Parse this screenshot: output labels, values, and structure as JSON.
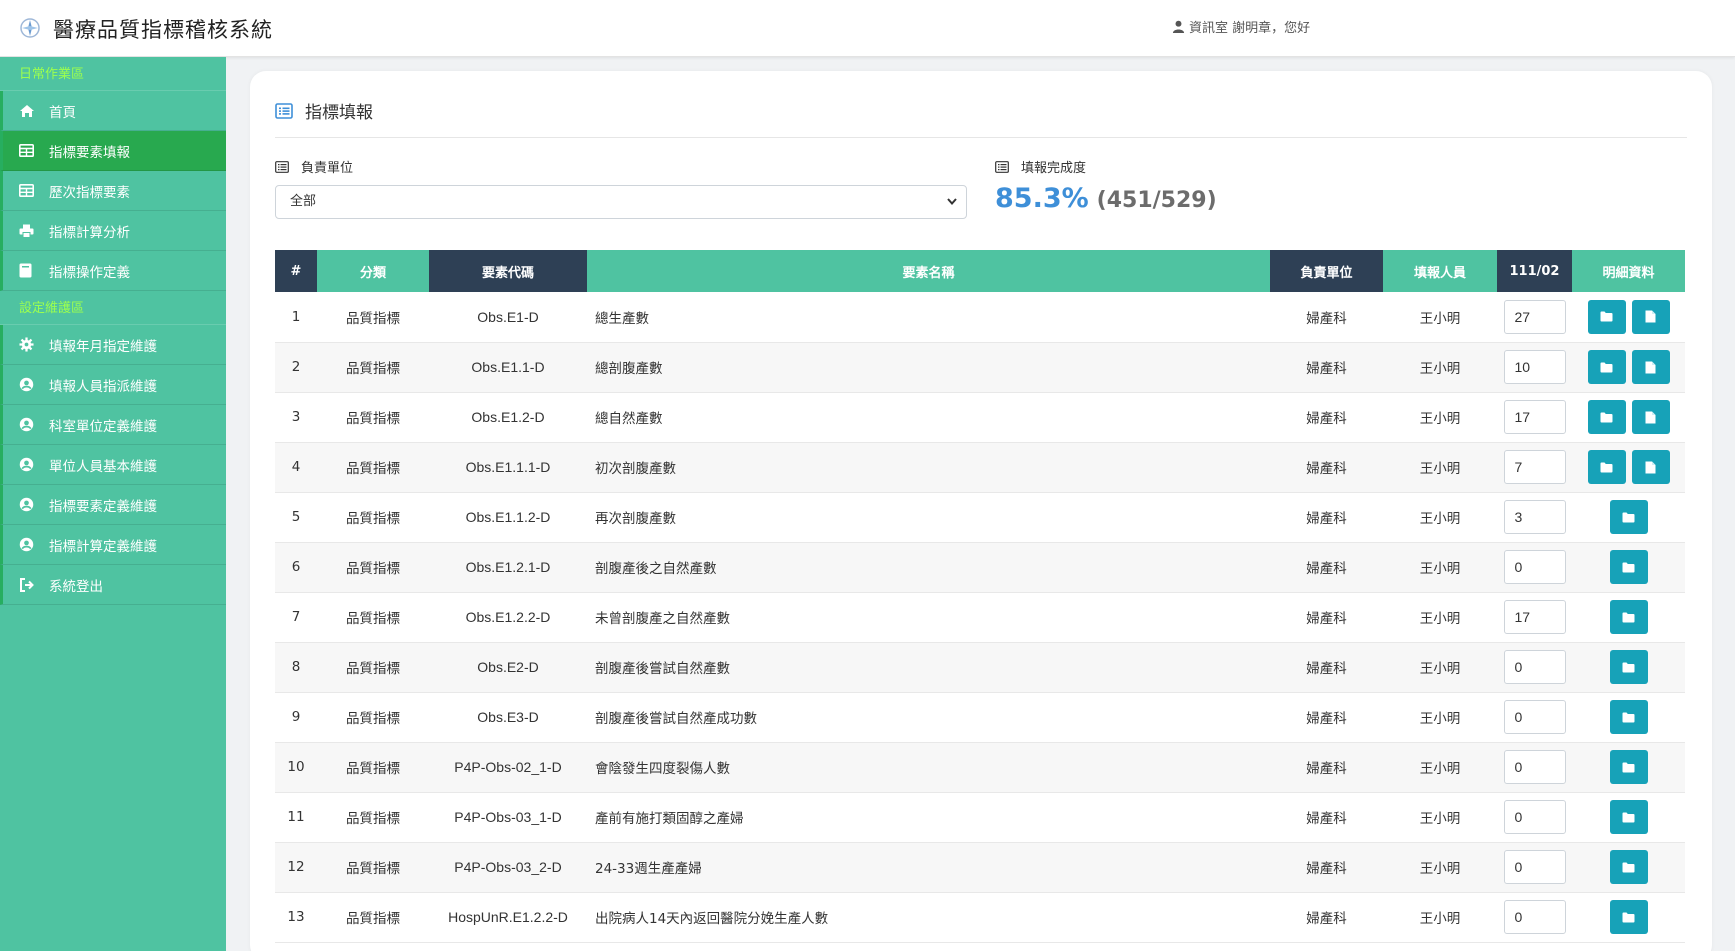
{
  "header": {
    "app_title": "醫療品質指標稽核系統",
    "user_text": "資訊室 謝明章，您好"
  },
  "sidebar": {
    "section1": "日常作業區",
    "items1": [
      {
        "label": "首頁",
        "icon": "home-icon"
      },
      {
        "label": "指標要素填報",
        "icon": "table-icon",
        "active": true
      },
      {
        "label": "歷次指標要素",
        "icon": "table-icon"
      },
      {
        "label": "指標計算分析",
        "icon": "print-icon"
      },
      {
        "label": "指標操作定義",
        "icon": "book-icon"
      }
    ],
    "section2": "設定維護區",
    "items2": [
      {
        "label": "填報年月指定維護",
        "icon": "gear-icon"
      },
      {
        "label": "填報人員指派維護",
        "icon": "user-circle-icon"
      },
      {
        "label": "科室單位定義維護",
        "icon": "user-circle-icon"
      },
      {
        "label": "單位人員基本維護",
        "icon": "user-circle-icon"
      },
      {
        "label": "指標要素定義維護",
        "icon": "user-circle-icon"
      },
      {
        "label": "指標計算定義維護",
        "icon": "user-circle-icon"
      },
      {
        "label": "系統登出",
        "icon": "sign-out-icon"
      }
    ]
  },
  "main": {
    "title": "指標填報",
    "unit_label": "負責單位",
    "unit_selected": "全部",
    "progress_label": "填報完成度",
    "progress_percent": "85.3%",
    "progress_count": "(451/529)"
  },
  "table": {
    "headers": {
      "idx": "#",
      "category": "分類",
      "code": "要素代碼",
      "name": "要素名稱",
      "unit": "負責單位",
      "filler": "填報人員",
      "period": "111/02",
      "detail": "明細資料"
    },
    "rows": [
      {
        "idx": "1",
        "category": "品質指標",
        "code": "Obs.E1-D",
        "name": "總生產數",
        "unit": "婦產科",
        "filler": "王小明",
        "value": "27",
        "doc": true
      },
      {
        "idx": "2",
        "category": "品質指標",
        "code": "Obs.E1.1-D",
        "name": "總剖腹產數",
        "unit": "婦產科",
        "filler": "王小明",
        "value": "10",
        "doc": true
      },
      {
        "idx": "3",
        "category": "品質指標",
        "code": "Obs.E1.2-D",
        "name": "總自然產數",
        "unit": "婦產科",
        "filler": "王小明",
        "value": "17",
        "doc": true
      },
      {
        "idx": "4",
        "category": "品質指標",
        "code": "Obs.E1.1.1-D",
        "name": "初次剖腹產數",
        "unit": "婦產科",
        "filler": "王小明",
        "value": "7",
        "doc": true
      },
      {
        "idx": "5",
        "category": "品質指標",
        "code": "Obs.E1.1.2-D",
        "name": "再次剖腹產數",
        "unit": "婦產科",
        "filler": "王小明",
        "value": "3",
        "doc": false
      },
      {
        "idx": "6",
        "category": "品質指標",
        "code": "Obs.E1.2.1-D",
        "name": "剖腹產後之自然產數",
        "unit": "婦產科",
        "filler": "王小明",
        "value": "0",
        "doc": false
      },
      {
        "idx": "7",
        "category": "品質指標",
        "code": "Obs.E1.2.2-D",
        "name": "未曾剖腹產之自然產數",
        "unit": "婦產科",
        "filler": "王小明",
        "value": "17",
        "doc": false
      },
      {
        "idx": "8",
        "category": "品質指標",
        "code": "Obs.E2-D",
        "name": "剖腹產後嘗試自然產數",
        "unit": "婦產科",
        "filler": "王小明",
        "value": "0",
        "doc": false
      },
      {
        "idx": "9",
        "category": "品質指標",
        "code": "Obs.E3-D",
        "name": "剖腹產後嘗試自然產成功數",
        "unit": "婦產科",
        "filler": "王小明",
        "value": "0",
        "doc": false
      },
      {
        "idx": "10",
        "category": "品質指標",
        "code": "P4P-Obs-02_1-D",
        "name": "會陰發生四度裂傷人數",
        "unit": "婦產科",
        "filler": "王小明",
        "value": "0",
        "doc": false
      },
      {
        "idx": "11",
        "category": "品質指標",
        "code": "P4P-Obs-03_1-D",
        "name": "產前有施打類固醇之產婦",
        "unit": "婦產科",
        "filler": "王小明",
        "value": "0",
        "doc": false
      },
      {
        "idx": "12",
        "category": "品質指標",
        "code": "P4P-Obs-03_2-D",
        "name": "24-33週生產產婦",
        "unit": "婦產科",
        "filler": "王小明",
        "value": "0",
        "doc": false
      },
      {
        "idx": "13",
        "category": "品質指標",
        "code": "HospUnR.E1.2.2-D",
        "name": "出院病人14天內返回醫院分娩生產人數",
        "unit": "婦產科",
        "filler": "王小明",
        "value": "0",
        "doc": false
      }
    ]
  }
}
